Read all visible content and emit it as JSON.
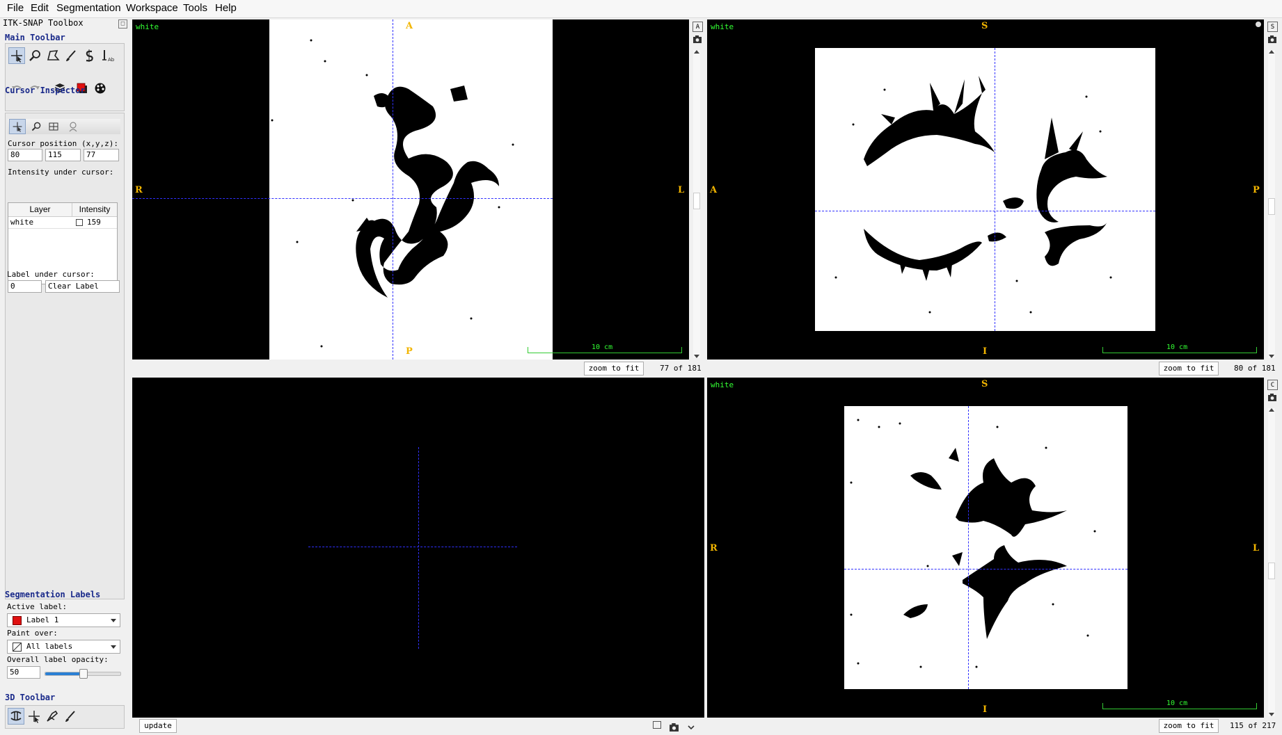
{
  "menubar": {
    "items": [
      "File",
      "Edit",
      "Segmentation",
      "Workspace",
      "Tools",
      "Help"
    ]
  },
  "toolbox": {
    "title": "ITK-SNAP Toolbox",
    "main_toolbar": {
      "heading": "Main Toolbar",
      "tools": [
        "crosshair-tool-icon",
        "zoom-tool-icon",
        "polygon-tool-icon",
        "paintbrush-tool-icon",
        "snake-tool-icon",
        "annotation-tool-icon"
      ],
      "actions": [
        "undo-icon",
        "redo-icon",
        "layers-icon",
        "label-color-icon",
        "palette-icon"
      ]
    },
    "cursor_inspector": {
      "heading": "Cursor Inspector",
      "position_label": "Cursor position (x,y,z):",
      "x": "80",
      "y": "115",
      "z": "77",
      "intensity_label": "Intensity under cursor:",
      "columns": [
        "Layer",
        "Intensity"
      ],
      "rows": [
        {
          "layer": "white",
          "intensity": "159"
        }
      ],
      "label_under_label": "Label under cursor:",
      "label_id": "0",
      "label_name": "Clear Label"
    },
    "segmentation_labels": {
      "heading": "Segmentation Labels",
      "active_label_label": "Active label:",
      "active_label": "Label 1",
      "active_color": "#e01010",
      "paint_over_label": "Paint over:",
      "paint_over": "All labels",
      "opacity_label": "Overall label opacity:",
      "opacity": "50",
      "opacity_fraction": 0.5
    },
    "toolbar_3d": {
      "heading": "3D Toolbar"
    }
  },
  "views": {
    "axial": {
      "layer": "white",
      "top": "A",
      "bottom": "P",
      "left": "R",
      "right": "L",
      "scale": "10 cm",
      "zoom_btn": "zoom to fit",
      "slice": "77 of 181"
    },
    "sagittal": {
      "layer": "white",
      "top": "S",
      "bottom": "I",
      "left": "A",
      "right": "P",
      "scale": "10 cm",
      "zoom_btn": "zoom to fit",
      "slice": "80 of 181"
    },
    "view3d": {
      "update_btn": "update"
    },
    "coronal": {
      "layer": "white",
      "top": "S",
      "bottom": "I",
      "left": "R",
      "right": "L",
      "scale": "10 cm",
      "zoom_btn": "zoom to fit",
      "slice": "115 of 217"
    }
  }
}
